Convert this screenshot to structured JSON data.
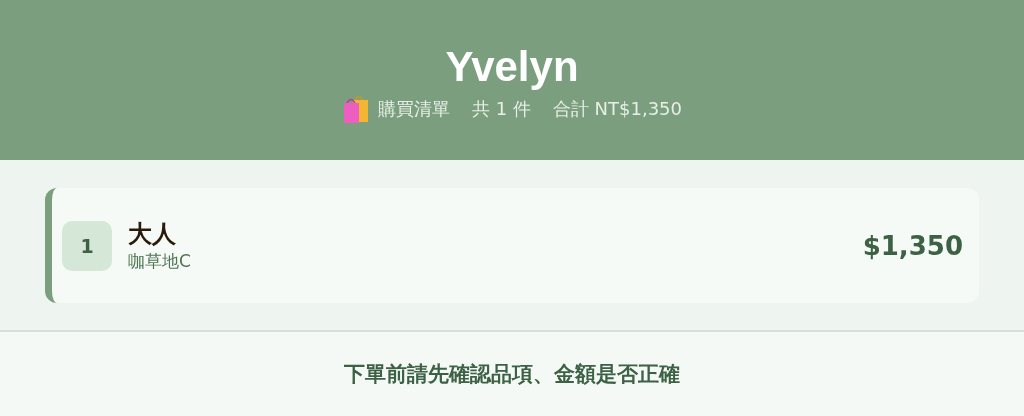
{
  "header": {
    "title": "Yvelyn",
    "subtitle": [
      "購買清單",
      "共 1 件",
      "合計 NT$1,350"
    ]
  },
  "items": [
    {
      "index": "1",
      "name": "大人",
      "option": "咖草地C",
      "price": "$1,350"
    }
  ],
  "footer": {
    "notice": "下單前請先確認品項、金額是否正確"
  }
}
